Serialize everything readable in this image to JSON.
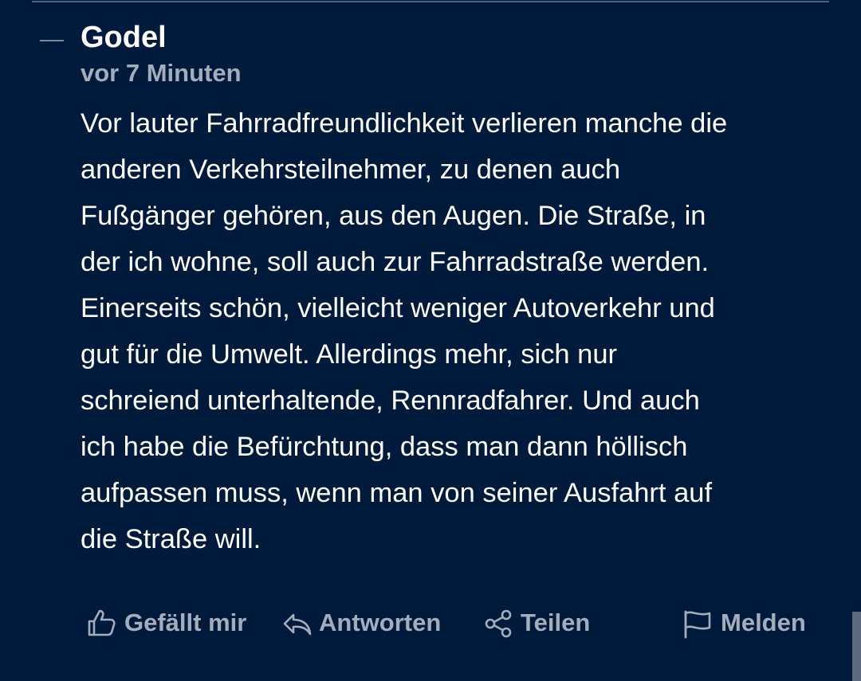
{
  "comment": {
    "collapse_label": "—",
    "author": "Godel",
    "timestamp": "vor 7 Minuten",
    "body_lines": [
      "Vor lauter Fahrradfreundlichkeit verlieren manche die",
      "anderen Verkehrsteilnehmer, zu denen auch",
      "Fußgänger gehören, aus den Augen. Die Straße, in",
      "der ich wohne, soll auch zur Fahrradstraße werden.",
      "Einerseits schön, vielleicht weniger Autoverkehr und",
      "gut für die Umwelt. Allerdings mehr, sich nur",
      "schreiend unterhaltende, Rennradfahrer. Und auch",
      "ich habe die Befürchtung, dass man dann höllisch",
      "aufpassen muss, wenn man von seiner Ausfahrt auf",
      "die Straße will."
    ]
  },
  "actions": {
    "like": {
      "label": "Gefällt mir",
      "icon": "thumbs-up-icon"
    },
    "reply": {
      "label": "Antworten",
      "icon": "reply-icon"
    },
    "share": {
      "label": "Teilen",
      "icon": "share-icon"
    },
    "report": {
      "label": "Melden",
      "icon": "flag-icon"
    }
  },
  "colors": {
    "background": "#001a3b",
    "text": "#ffffff",
    "muted": "#a4adbb"
  }
}
